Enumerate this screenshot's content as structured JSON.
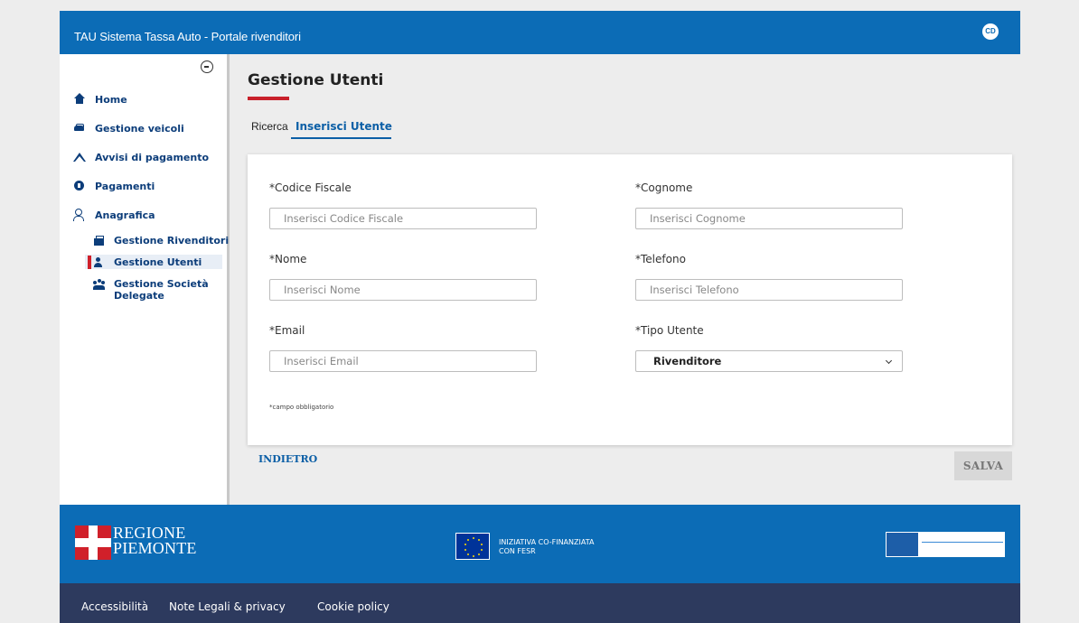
{
  "header": {
    "title": "TAU Sistema Tassa Auto - Portale rivenditori",
    "avatar": "CD"
  },
  "sidebar": {
    "items": [
      {
        "label": "Home",
        "icon": "home-icon"
      },
      {
        "label": "Gestione veicoli",
        "icon": "car-icon"
      },
      {
        "label": "Avvisi di pagamento",
        "icon": "mountain-icon"
      },
      {
        "label": "Pagamenti",
        "icon": "payment-icon"
      },
      {
        "label": "Anagrafica",
        "icon": "person-icon"
      }
    ],
    "subitems": [
      {
        "label": "Gestione Rivenditori",
        "icon": "shop-icon"
      },
      {
        "label": "Gestione Utenti",
        "icon": "user-icon",
        "active": true
      },
      {
        "label": "Gestione Società Delegate",
        "icon": "users-icon"
      }
    ]
  },
  "main": {
    "title": "Gestione Utenti",
    "tabs": [
      {
        "label": "Ricerca"
      },
      {
        "label": "Inserisci Utente",
        "active": true
      }
    ],
    "form": {
      "codice_fiscale": {
        "label": "*Codice Fiscale",
        "placeholder": "Inserisci Codice Fiscale"
      },
      "cognome": {
        "label": "*Cognome",
        "placeholder": "Inserisci Cognome"
      },
      "nome": {
        "label": "*Nome",
        "placeholder": "Inserisci Nome"
      },
      "telefono": {
        "label": "*Telefono",
        "placeholder": "Inserisci Telefono"
      },
      "email": {
        "label": "*Email",
        "placeholder": "Inserisci Email"
      },
      "tipo_utente": {
        "label": "*Tipo Utente",
        "value": "Rivenditore"
      },
      "required_note": "*campo obbligatorio"
    },
    "back_label": "INDIETRO",
    "save_label": "SALVA"
  },
  "footer": {
    "regione_line1": "REGIONE",
    "regione_line2": "PIEMONTE",
    "eu_line1": "INIZIATIVA CO-FINANZIATA",
    "eu_line2": "CON FESR",
    "links": [
      "Accessibilità",
      "Note Legali & privacy",
      "Cookie policy"
    ]
  },
  "colors": {
    "brand_blue": "#0c6cb6",
    "nav_text": "#0c3d7a",
    "accent_red": "#c8202a",
    "footer_dark": "#2d3a5e"
  }
}
